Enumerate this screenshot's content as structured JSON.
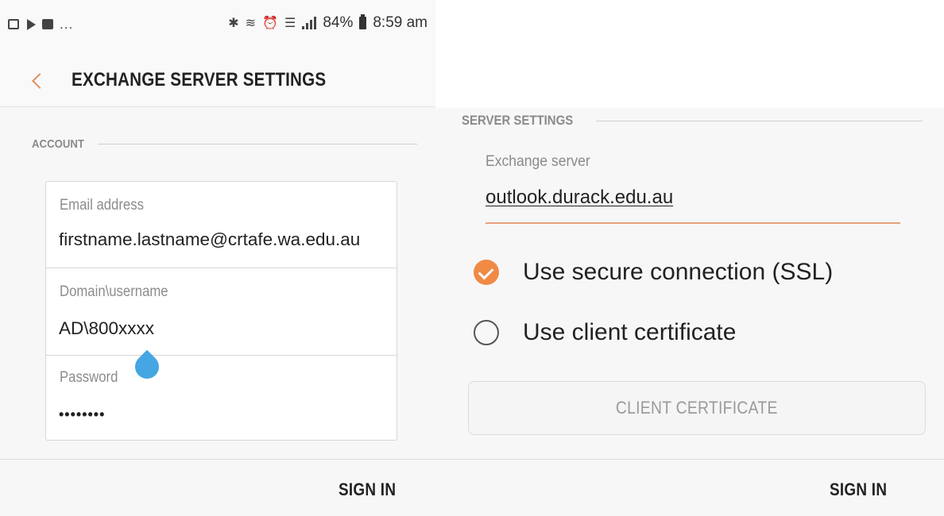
{
  "status_bar": {
    "battery_percent": "84%",
    "time": "8:59 am",
    "overflow": "...",
    "icons_left": [
      "gallery-icon",
      "play-icon",
      "message-icon"
    ],
    "icons_right": [
      "bluetooth-icon",
      "nfc-icon",
      "alarm-icon",
      "wifi-icon",
      "signal-icon",
      "battery-icon"
    ]
  },
  "app_bar": {
    "title": "EXCHANGE SERVER SETTINGS",
    "back_icon": "chevron-left-icon",
    "accent_color": "#e58d5c"
  },
  "account": {
    "section_label": "ACCOUNT",
    "email": {
      "label": "Email address",
      "value": "firstname.lastname@crtafe.wa.edu.au"
    },
    "username": {
      "label": "Domain\\username",
      "value": "AD\\800xxxx"
    },
    "password": {
      "label": "Password",
      "value": "••••••••"
    }
  },
  "server": {
    "section_label": "SERVER SETTINGS",
    "exchange_label": "Exchange server",
    "exchange_value": "outlook.durack.edu.au",
    "ssl_option": {
      "label": "Use secure connection (SSL)",
      "checked": true
    },
    "client_cert_option": {
      "label": "Use client certificate",
      "checked": false
    },
    "client_cert_button": "CLIENT CERTIFICATE",
    "check_color": "#f08a45"
  },
  "footer": {
    "sign_in_left": "SIGN IN",
    "sign_in_right": "SIGN IN"
  }
}
